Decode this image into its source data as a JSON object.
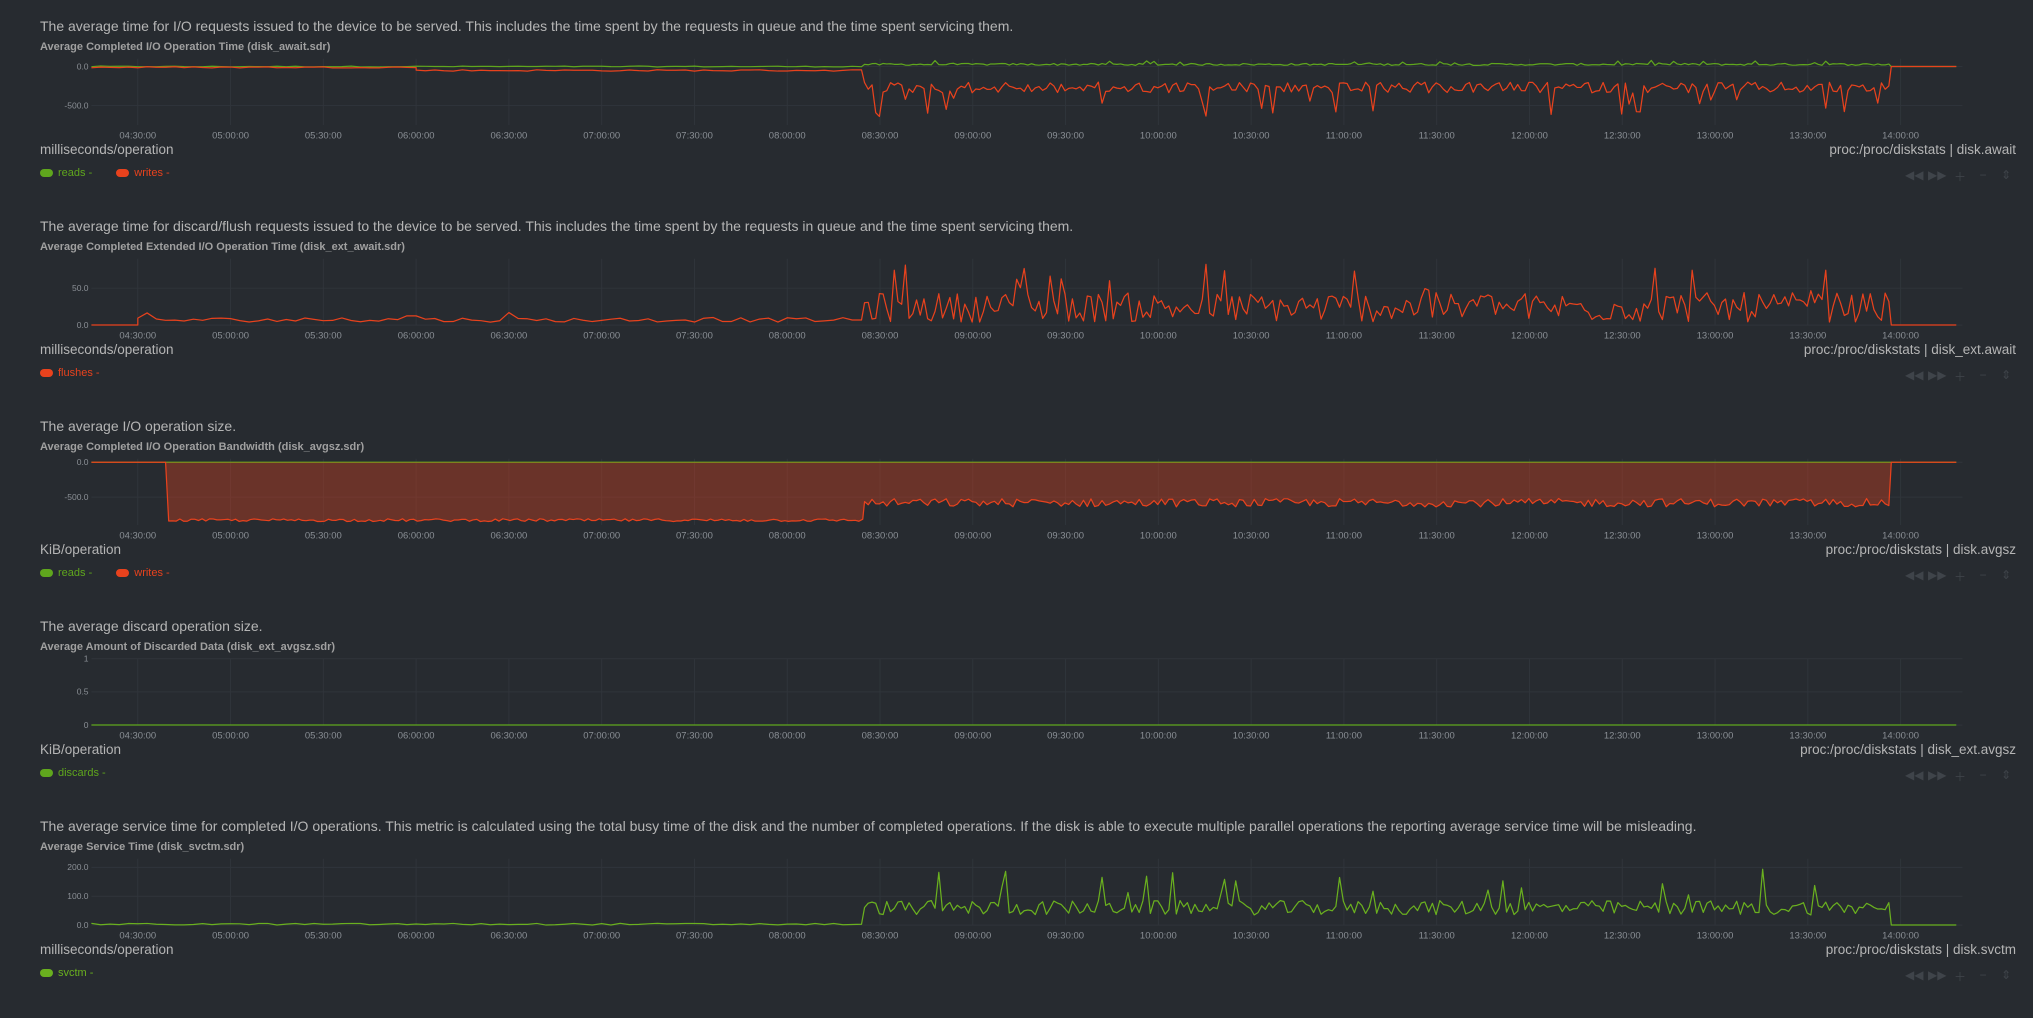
{
  "time_ticks": [
    "04:30:00",
    "05:00:00",
    "05:30:00",
    "06:00:00",
    "06:30:00",
    "07:00:00",
    "07:30:00",
    "08:00:00",
    "08:30:00",
    "09:00:00",
    "09:30:00",
    "10:00:00",
    "10:30:00",
    "11:00:00",
    "11:30:00",
    "12:00:00",
    "12:30:00",
    "13:00:00",
    "13:30:00",
    "14:00:00"
  ],
  "colors": {
    "background": "#272b30",
    "reads": "#5fa61d",
    "writes": "#e8421d",
    "flushes": "#e8421d",
    "discards": "#5fa61d",
    "svctm": "#6ab01f",
    "grid": "#30353b"
  },
  "panels": [
    {
      "description": "The average time for I/O requests issued to the device to be served. This includes the time spent by the requests in queue and the time spent servicing them.",
      "title": "Average Completed I/O Operation Time (disk_await.sdr)",
      "units": "milliseconds/operation",
      "context": "proc:/proc/diskstats | disk.await",
      "legend": [
        {
          "label": "reads -",
          "color": "#5fa61d"
        },
        {
          "label": "writes -",
          "color": "#e8421d"
        }
      ]
    },
    {
      "description": "The average time for discard/flush requests issued to the device to be served. This includes the time spent by the requests in queue and the time spent servicing them.",
      "title": "Average Completed Extended I/O Operation Time (disk_ext_await.sdr)",
      "units": "milliseconds/operation",
      "context": "proc:/proc/diskstats | disk_ext.await",
      "legend": [
        {
          "label": "flushes -",
          "color": "#e8421d"
        }
      ]
    },
    {
      "description": "The average I/O operation size.",
      "title": "Average Completed I/O Operation Bandwidth (disk_avgsz.sdr)",
      "units": "KiB/operation",
      "context": "proc:/proc/diskstats | disk.avgsz",
      "legend": [
        {
          "label": "reads -",
          "color": "#5fa61d"
        },
        {
          "label": "writes -",
          "color": "#e8421d"
        }
      ]
    },
    {
      "description": "The average discard operation size.",
      "title": "Average Amount of Discarded Data (disk_ext_avgsz.sdr)",
      "units": "KiB/operation",
      "context": "proc:/proc/diskstats | disk_ext.avgsz",
      "legend": [
        {
          "label": "discards -",
          "color": "#5fa61d"
        }
      ]
    },
    {
      "description": "The average service time for completed I/O operations. This metric is calculated using the total busy time of the disk and the number of completed operations. If the disk is able to execute multiple parallel operations the reporting average service time will be misleading.",
      "title": "Average Service Time (disk_svctm.sdr)",
      "units": "milliseconds/operation",
      "context": "proc:/proc/diskstats | disk.svctm",
      "legend": [
        {
          "label": "svctm -",
          "color": "#6ab01f"
        }
      ]
    }
  ],
  "chart_data": [
    {
      "type": "line",
      "title": "Average Completed I/O Operation Time (disk_await.sdr)",
      "ylabel": "milliseconds/operation",
      "y_ticks": [
        "0.0",
        "-500.0"
      ],
      "ylim": [
        -750,
        100
      ],
      "x_range": [
        "04:15:00",
        "14:20:00"
      ],
      "series": [
        {
          "name": "reads",
          "color": "#5fa61d",
          "segments": [
            {
              "from": "04:15:00",
              "to": "08:25:00",
              "base": 0,
              "noise": 6
            },
            {
              "from": "08:25:00",
              "to": "13:57:00",
              "base": 15,
              "noise": 25,
              "spike": 80
            },
            {
              "from": "13:57:00",
              "to": "14:20:00",
              "base": 0,
              "noise": 0
            }
          ]
        },
        {
          "name": "writes",
          "color": "#e8421d",
          "segments": [
            {
              "from": "04:15:00",
              "to": "06:00:00",
              "base": -10,
              "noise": 8
            },
            {
              "from": "06:00:00",
              "to": "08:25:00",
              "base": -50,
              "noise": 10
            },
            {
              "from": "08:25:00",
              "to": "13:57:00",
              "base": -200,
              "noise": 140,
              "spike": -650
            },
            {
              "from": "13:57:00",
              "to": "14:20:00",
              "base": 0,
              "noise": 0
            }
          ]
        }
      ]
    },
    {
      "type": "line",
      "title": "Average Completed Extended I/O Operation Time (disk_ext_await.sdr)",
      "ylabel": "milliseconds/operation",
      "y_ticks": [
        "50.0",
        "0.0"
      ],
      "ylim": [
        0,
        90
      ],
      "x_range": [
        "04:15:00",
        "14:20:00"
      ],
      "series": [
        {
          "name": "flushes",
          "color": "#e8421d",
          "segments": [
            {
              "from": "04:15:00",
              "to": "04:30:00",
              "base": 0,
              "noise": 0
            },
            {
              "from": "04:30:00",
              "to": "08:25:00",
              "base": 4,
              "noise": 6,
              "spike": 18
            },
            {
              "from": "08:25:00",
              "to": "13:57:00",
              "base": 4,
              "noise": 40,
              "spike": 85
            },
            {
              "from": "13:57:00",
              "to": "14:20:00",
              "base": 0,
              "noise": 0
            }
          ]
        }
      ]
    },
    {
      "type": "area",
      "title": "Average Completed I/O Operation Bandwidth (disk_avgsz.sdr)",
      "ylabel": "KiB/operation",
      "y_ticks": [
        "0.0",
        "-500.0"
      ],
      "ylim": [
        -900,
        50
      ],
      "x_range": [
        "04:15:00",
        "14:20:00"
      ],
      "series": [
        {
          "name": "reads",
          "color": "#5fa61d",
          "segments": [
            {
              "from": "04:15:00",
              "to": "14:20:00",
              "base": 0,
              "noise": 0
            }
          ]
        },
        {
          "name": "writes",
          "color": "#e8421d",
          "segments": [
            {
              "from": "04:15:00",
              "to": "04:40:00",
              "base": 0,
              "noise": 0
            },
            {
              "from": "04:40:00",
              "to": "08:25:00",
              "base": -830,
              "noise": 20
            },
            {
              "from": "08:25:00",
              "to": "13:57:00",
              "base": -580,
              "noise": 60
            },
            {
              "from": "13:57:00",
              "to": "14:20:00",
              "base": 0,
              "noise": 0
            }
          ]
        }
      ]
    },
    {
      "type": "line",
      "title": "Average Amount of Discarded Data (disk_ext_avgsz.sdr)",
      "ylabel": "KiB/operation",
      "y_ticks": [
        "1",
        "0.5",
        "0"
      ],
      "ylim": [
        0,
        1
      ],
      "x_range": [
        "04:15:00",
        "14:20:00"
      ],
      "series": [
        {
          "name": "discards",
          "color": "#5fa61d",
          "segments": [
            {
              "from": "04:15:00",
              "to": "14:20:00",
              "base": 0,
              "noise": 0
            }
          ]
        }
      ]
    },
    {
      "type": "line",
      "title": "Average Service Time (disk_svctm.sdr)",
      "ylabel": "milliseconds/operation",
      "y_ticks": [
        "200.0",
        "100.0",
        "0.0"
      ],
      "ylim": [
        0,
        230
      ],
      "x_range": [
        "04:15:00",
        "14:20:00"
      ],
      "series": [
        {
          "name": "svctm",
          "color": "#6ab01f",
          "segments": [
            {
              "from": "04:15:00",
              "to": "08:25:00",
              "base": 3,
              "noise": 3
            },
            {
              "from": "08:25:00",
              "to": "13:57:00",
              "base": 35,
              "noise": 50,
              "spike": 200
            },
            {
              "from": "13:57:00",
              "to": "14:20:00",
              "base": 0,
              "noise": 0
            }
          ]
        }
      ]
    }
  ]
}
